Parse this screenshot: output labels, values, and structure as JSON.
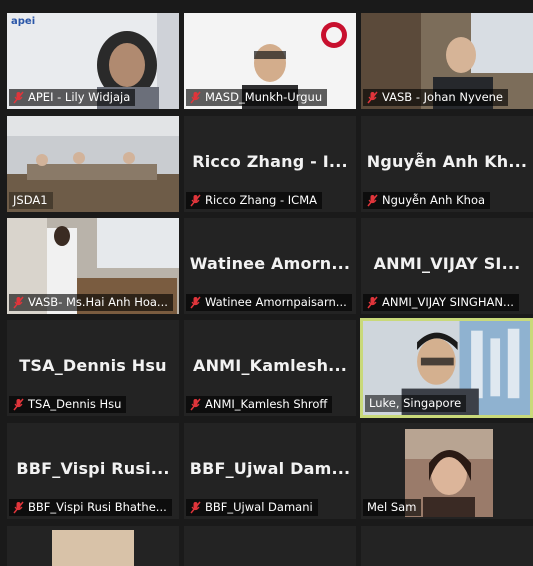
{
  "participants": [
    {
      "id": "p1",
      "label": "APEI - Lily Widjaja",
      "big": "",
      "logo": "apei",
      "muted": true
    },
    {
      "id": "p2",
      "label": "MASD_Munkh-Urguu",
      "big": "",
      "muted": true
    },
    {
      "id": "p3",
      "label": "VASB - Johan Nyvene",
      "big": "",
      "muted": true
    },
    {
      "id": "p4",
      "label": "JSDA1",
      "big": "",
      "muted": false
    },
    {
      "id": "p5",
      "label": "Ricco Zhang - ICMA",
      "big": "Ricco Zhang - I...",
      "muted": true
    },
    {
      "id": "p6",
      "label": "Nguyễn Anh Khoa",
      "big": "Nguyễn Anh Kh...",
      "muted": true
    },
    {
      "id": "p7",
      "label": "VASB- Ms.Hai Anh Hoa...",
      "big": "",
      "muted": true
    },
    {
      "id": "p8",
      "label": "Watinee Amornpaisarn...",
      "big": "Watinee Amorn...",
      "muted": true
    },
    {
      "id": "p9",
      "label": "ANMI_VIJAY SINGHAN...",
      "big": "ANMI_VIJAY SI...",
      "muted": true
    },
    {
      "id": "p10",
      "label": "TSA_Dennis Hsu",
      "big": "TSA_Dennis Hsu",
      "muted": true
    },
    {
      "id": "p11",
      "label": "ANMI_Kamlesh Shroff",
      "big": "ANMI_Kamlesh...",
      "muted": true
    },
    {
      "id": "p12",
      "label": "Luke, Singapore",
      "big": "",
      "muted": false,
      "active": true
    },
    {
      "id": "p13",
      "label": "BBF_Vispi Rusi Bhathe...",
      "big": "BBF_Vispi Rusi...",
      "muted": true
    },
    {
      "id": "p14",
      "label": "BBF_Ujwal Damani",
      "big": "BBF_Ujwal Dam...",
      "muted": true
    },
    {
      "id": "p15",
      "label": "Mel Sam",
      "big": "",
      "muted": false
    }
  ],
  "colors": {
    "mic_muted": "#e0353b",
    "active_border": "#c9d97a",
    "tile_bg": "#232323"
  }
}
